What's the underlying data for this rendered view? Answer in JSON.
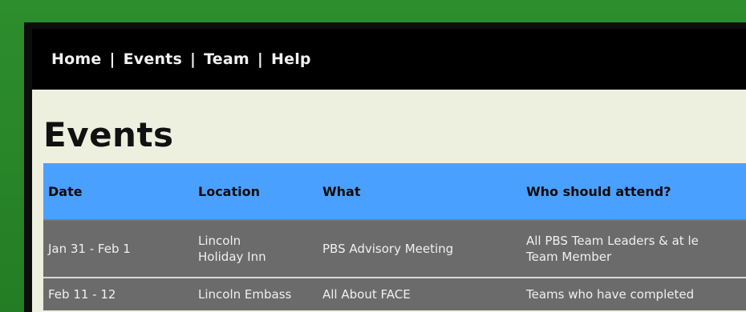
{
  "nav": {
    "items": [
      {
        "label": "Home"
      },
      {
        "label": "Events"
      },
      {
        "label": "Team"
      },
      {
        "label": "Help"
      }
    ],
    "separator": "|"
  },
  "page": {
    "title": "Events"
  },
  "table": {
    "headers": {
      "date": "Date",
      "location": "Location",
      "what": "What",
      "who": "Who should attend?"
    },
    "rows": [
      {
        "date": "Jan 31 - Feb 1",
        "location_line1": "Lincoln",
        "location_line2": "Holiday Inn",
        "what": "PBS Advisory Meeting",
        "who_line1": "All PBS Team Leaders & at le",
        "who_line2": "Team Member"
      },
      {
        "date": "Feb 11 - 12",
        "location_line1": "Lincoln Embass",
        "what": "All About FACE",
        "who_line1": "Teams who have completed"
      }
    ]
  },
  "colors": {
    "background_green": "#2f8a2f",
    "nav_bar": "#000000",
    "content_bg": "#eef0df",
    "table_header": "#4aa0ff",
    "table_row": "#6b6b6b"
  }
}
